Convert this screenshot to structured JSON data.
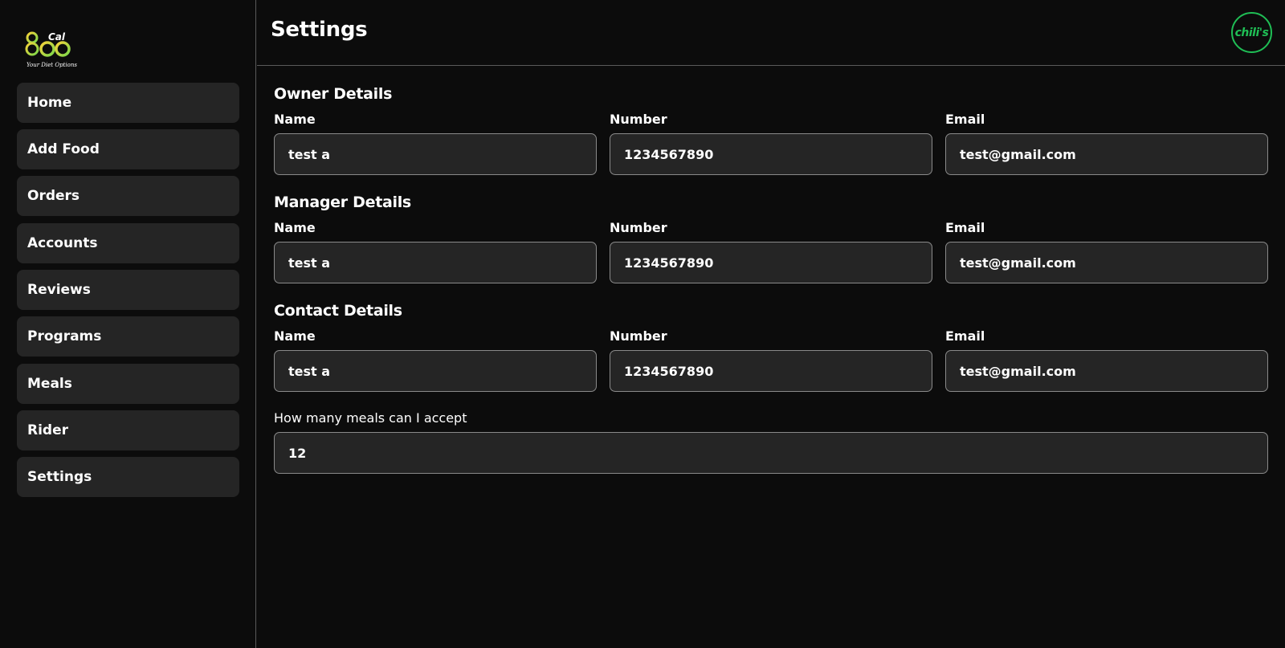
{
  "brand": {
    "logo_alt": "800 Cal - Your Diet Options",
    "logo_digits": "800",
    "logo_word": "Cal",
    "logo_tagline": "Your Diet Options",
    "restaurant_badge": "chili's",
    "accent_color": "#1fbe55"
  },
  "sidebar": {
    "items": [
      {
        "label": "Home"
      },
      {
        "label": "Add Food"
      },
      {
        "label": "Orders"
      },
      {
        "label": "Accounts"
      },
      {
        "label": "Reviews"
      },
      {
        "label": "Programs"
      },
      {
        "label": "Meals"
      },
      {
        "label": "Rider"
      },
      {
        "label": "Settings"
      }
    ]
  },
  "header": {
    "title": "Settings"
  },
  "sections": [
    {
      "title": "Owner Details",
      "name_label": "Name",
      "name_value": "test a",
      "number_label": "Number",
      "number_value": "1234567890",
      "email_label": "Email",
      "email_value": "test@gmail.com"
    },
    {
      "title": "Manager Details",
      "name_label": "Name",
      "name_value": "test a",
      "number_label": "Number",
      "number_value": "1234567890",
      "email_label": "Email",
      "email_value": "test@gmail.com"
    },
    {
      "title": "Contact Details",
      "name_label": "Name",
      "name_value": "test a",
      "number_label": "Number",
      "number_value": "1234567890",
      "email_label": "Email",
      "email_value": "test@gmail.com"
    }
  ],
  "meals": {
    "label": "How many meals can I accept",
    "value": "12"
  }
}
